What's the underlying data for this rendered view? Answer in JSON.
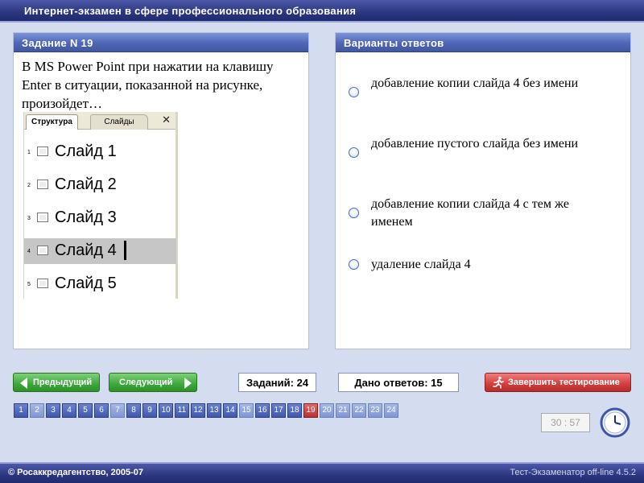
{
  "header": {
    "title": "Интернет-экзамен в сфере профессионального образования"
  },
  "task": {
    "heading": "Задание N 19",
    "question": "В MS Power Point при нажатии на клавишу Enter в ситуации, показанной на рисунке, произойдет…",
    "figure": {
      "tabs": [
        "Структура",
        "Слайды"
      ],
      "close_glyph": "✕",
      "slides": [
        {
          "num": "1",
          "label": "Слайд 1"
        },
        {
          "num": "2",
          "label": "Слайд 2"
        },
        {
          "num": "3",
          "label": "Слайд 3"
        },
        {
          "num": "4",
          "label": "Слайд 4"
        },
        {
          "num": "5",
          "label": "Слайд 5"
        }
      ],
      "selected_slide": "4"
    }
  },
  "answers": {
    "heading": "Варианты ответов",
    "options": [
      "добавление копии слайда 4 без имени",
      "добавление пустого слайда без имени",
      "добавление копии слайда 4 с тем же именем",
      "удаление слайда 4"
    ]
  },
  "nav": {
    "prev_label": "Предыдущий",
    "next_label": "Следующий",
    "tasks_count": "Заданий: 24",
    "answers_given": "Дано ответов: 15",
    "finish_label": "Завершить тестирование"
  },
  "pages": {
    "numbers": [
      "1",
      "2",
      "3",
      "4",
      "5",
      "6",
      "7",
      "8",
      "9",
      "10",
      "11",
      "12",
      "13",
      "14",
      "15",
      "16",
      "17",
      "18",
      "19",
      "20",
      "21",
      "22",
      "23",
      "24"
    ],
    "current": "19",
    "light": [
      "2",
      "7",
      "15",
      "20",
      "21",
      "22",
      "23",
      "24"
    ]
  },
  "timer": {
    "value": "30 : 57"
  },
  "footer": {
    "copyright": "© Росаккредагентство, 2005-07",
    "version": "Тест-Экзаменатор off-line 4.5.2"
  },
  "colors": {
    "header_bg": "#2c3680",
    "panel_head": "#4f66b8",
    "nav_green": "#3da83a",
    "finish_red": "#d13e3e",
    "current_page": "#b63232"
  },
  "icons": {
    "prev": "arrow-left-icon",
    "next": "arrow-right-icon",
    "finish": "runner-icon",
    "clock": "clock-icon",
    "radio": "radio-icon"
  }
}
